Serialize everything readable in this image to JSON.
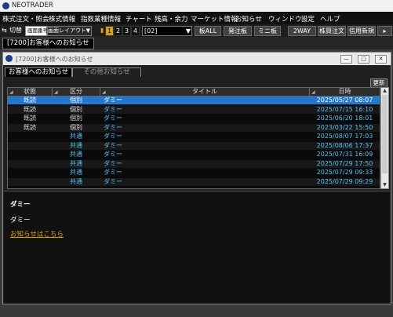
{
  "app": {
    "title": "NEOTRADER"
  },
  "menu": [
    "株式注文・照会",
    "株式情報",
    "指数業種情報",
    "チャート",
    "残高・余力",
    "マーケット情報",
    "お知らせ",
    "ウィンドウ",
    "設定",
    "ヘルプ"
  ],
  "toolbar": {
    "switch_label": "切替",
    "screen_no": "画面番号",
    "layout_select": "画面レイアウト",
    "nums": [
      "1",
      "2",
      "3",
      "4"
    ],
    "code_select": "[02]",
    "buttons": [
      "板ALL",
      "発注板",
      "ミニ板",
      "2WAY",
      "株買注文",
      "信用新規"
    ]
  },
  "page_tab": "[7200]お客様へのお知らせ",
  "window": {
    "title": "[7200]お客様へのお知らせ",
    "tabs": [
      "お客様へのお知らせ",
      "その他お知らせ"
    ],
    "refresh": "更新"
  },
  "table": {
    "headers": [
      "状態",
      "区分",
      "タイトル",
      "日時"
    ],
    "rows": [
      {
        "status": "既読",
        "category": "個別",
        "title": "ダミー",
        "datetime": "2025/05/27 08:07",
        "selected": true
      },
      {
        "status": "既読",
        "category": "個別",
        "title": "ダミー",
        "datetime": "2025/07/15 16:10",
        "selected": false
      },
      {
        "status": "既読",
        "category": "個別",
        "title": "ダミー",
        "datetime": "2025/06/20 18:01",
        "selected": false
      },
      {
        "status": "既読",
        "category": "個別",
        "title": "ダミー",
        "datetime": "2023/03/22 15:50",
        "selected": false
      },
      {
        "status": "",
        "category": "共通",
        "title": "ダミー",
        "datetime": "2025/08/07 17:03",
        "selected": false
      },
      {
        "status": "",
        "category": "共通",
        "title": "ダミー",
        "datetime": "2025/08/06 17:37",
        "selected": false
      },
      {
        "status": "",
        "category": "共通",
        "title": "ダミー",
        "datetime": "2025/07/31 16:09",
        "selected": false
      },
      {
        "status": "",
        "category": "共通",
        "title": "ダミー",
        "datetime": "2025/07/29 17:50",
        "selected": false
      },
      {
        "status": "",
        "category": "共通",
        "title": "ダミー",
        "datetime": "2025/07/29 09:33",
        "selected": false
      },
      {
        "status": "",
        "category": "共通",
        "title": "ダミー",
        "datetime": "2025/07/29 09:29",
        "selected": false
      }
    ]
  },
  "detail": {
    "title": "ダミー",
    "body": "ダミー",
    "link": "お知らせはこちら"
  },
  "colors": {
    "selected_row": "#1f78d1",
    "cyan_text": "#4fc3f7",
    "link": "#e0a300"
  }
}
